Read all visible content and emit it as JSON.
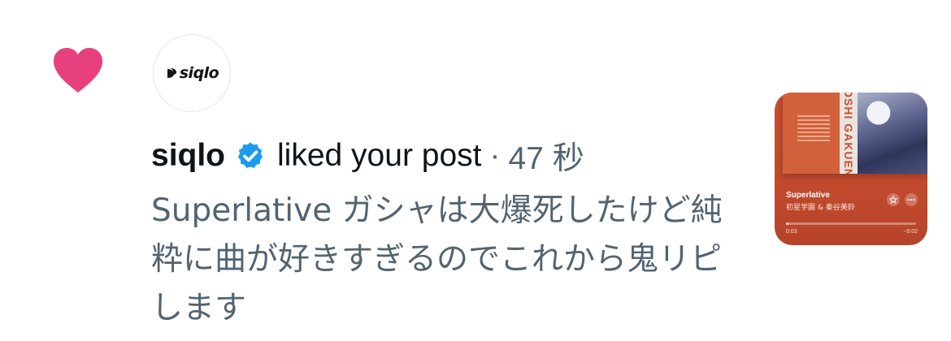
{
  "notification": {
    "avatar_text": "siqlo",
    "username": "siqlo",
    "action": "liked your post",
    "separator": "·",
    "timestamp": "47 秒",
    "post_text": "Superlative ガシャは大爆死したけど純粋に曲が好きすぎるのでこれから鬼リピします"
  },
  "thumbnail": {
    "album_vertical_text": "OSHI GAKUEN",
    "track_title": "Superlative",
    "track_artist": "初星学園 & 秦谷美鈴",
    "elapsed": "0:03",
    "remaining": "−5:02",
    "progress": 0.01
  },
  "colors": {
    "heart": "#e8407f",
    "verified": "#1d9bf0",
    "primary_text": "#0f1419",
    "secondary_text": "#536471",
    "thumbnail_bg": "#c94e30"
  },
  "icons": {
    "heart": "heart-icon",
    "verified": "verified-badge-icon",
    "star": "star-icon",
    "more": "more-icon"
  }
}
